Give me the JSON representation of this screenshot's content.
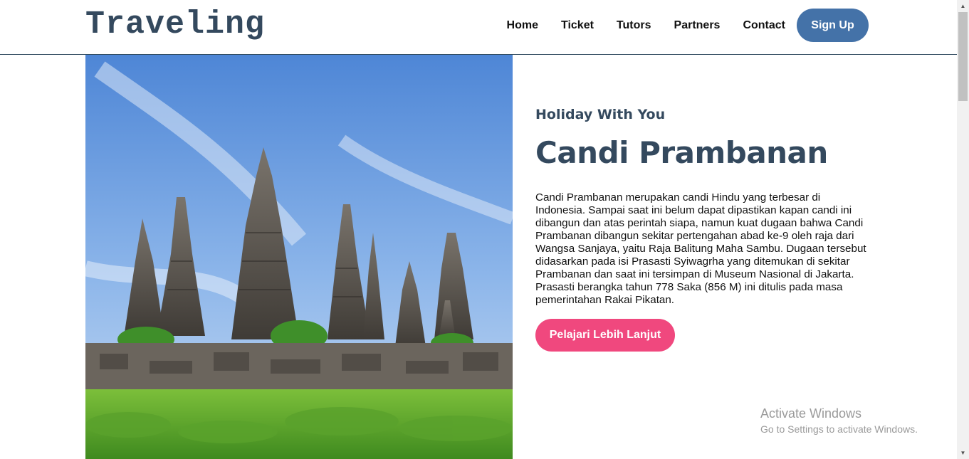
{
  "header": {
    "logo": "Traveling",
    "nav": [
      "Home",
      "Ticket",
      "Tutors",
      "Partners",
      "Contact"
    ],
    "signup_label": "Sign Up"
  },
  "hero": {
    "image_icon": "temple-photo",
    "eyebrow": "Holiday With You",
    "title": "Candi Prambanan",
    "description": "Candi Prambanan merupakan candi Hindu yang terbesar di Indonesia. Sampai saat ini belum dapat dipastikan kapan candi ini dibangun dan atas perintah siapa, namun kuat dugaan bahwa Candi Prambanan dibangun sekitar pertengahan abad ke-9 oleh raja dari Wangsa Sanjaya, yaitu Raja Balitung Maha Sambu. Dugaan tersebut didasarkan pada isi Prasasti Syiwagrha yang ditemukan di sekitar Prambanan dan saat ini tersimpan di Museum Nasional di Jakarta. Prasasti berangka tahun 778 Saka (856 M) ini ditulis pada masa pemerintahan Rakai Pikatan.",
    "cta_label": "Pelajari Lebih Lanjut"
  },
  "watermark": {
    "title": "Activate Windows",
    "subtitle": "Go to Settings to activate Windows."
  },
  "colors": {
    "primary": "#34495e",
    "signup": "#4472a8",
    "cta": "#f0487e"
  }
}
